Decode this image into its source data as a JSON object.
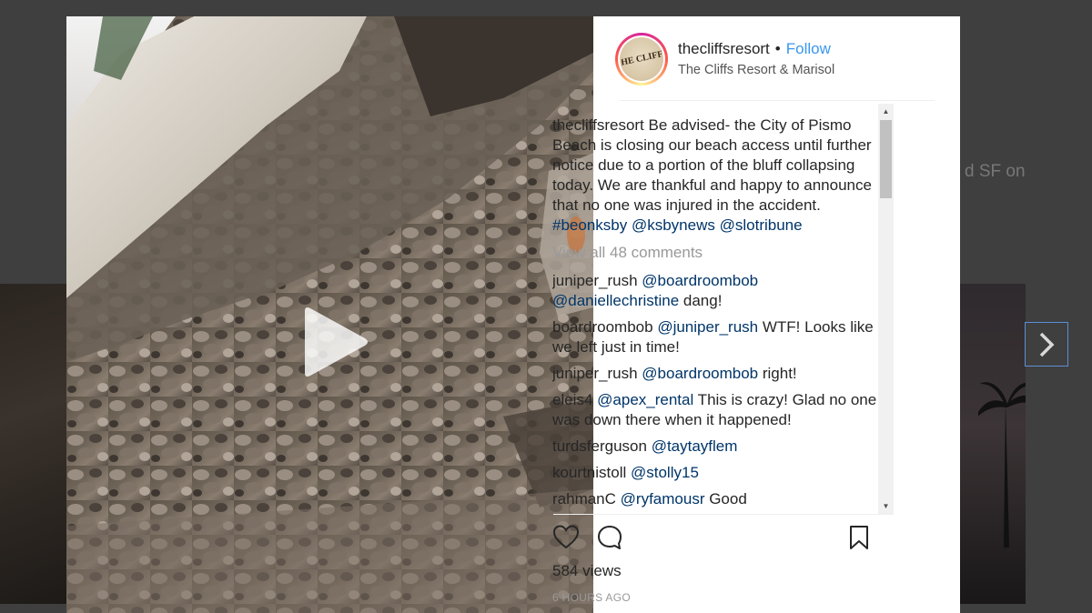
{
  "background": {
    "side_text": "d SF on"
  },
  "post": {
    "username": "thecliffsresort",
    "separator": "•",
    "follow_label": "Follow",
    "location": "The Cliffs Resort & Marisol",
    "avatar_text": "THE CLIFFS",
    "caption": {
      "username": "thecliffsresort",
      "text": " Be advised- the City of Pismo Beach is closing our beach access until further notice due to a portion of the bluff collapsing today. We are thankful and happy to announce that no one was injured in the accident. ",
      "tags": [
        "#beonksby",
        "@ksbynews",
        "@slotribune"
      ]
    },
    "view_all_label": "View all 48 comments",
    "comments": [
      {
        "user": "juniper_rush",
        "mentions": [
          "@boardroombob",
          "@daniellechristine"
        ],
        "text": " dang!"
      },
      {
        "user": "boardroombob",
        "mentions": [
          "@juniper_rush"
        ],
        "text": " WTF! Looks like we left just in time!"
      },
      {
        "user": "juniper_rush",
        "mentions": [
          "@boardroombob"
        ],
        "text": " right!"
      },
      {
        "user": "eleis4",
        "mentions": [
          "@apex_rental"
        ],
        "text": " This is crazy! Glad no one was down there when it happened!"
      },
      {
        "user": "turdsferguson",
        "mentions": [
          "@taytayflem"
        ],
        "text": ""
      },
      {
        "user": "kourtnistoll",
        "mentions": [
          "@stolly15"
        ],
        "text": ""
      },
      {
        "user": "rahmanC",
        "mentions": [
          "@ryfamousr"
        ],
        "text": " Good"
      }
    ],
    "views": "584 views",
    "timestamp": "6 HOURS AGO"
  },
  "icons": {
    "like": "heart-icon",
    "comment": "comment-bubble-icon",
    "save": "bookmark-icon",
    "play": "play-icon",
    "next": "chevron-right-icon"
  }
}
